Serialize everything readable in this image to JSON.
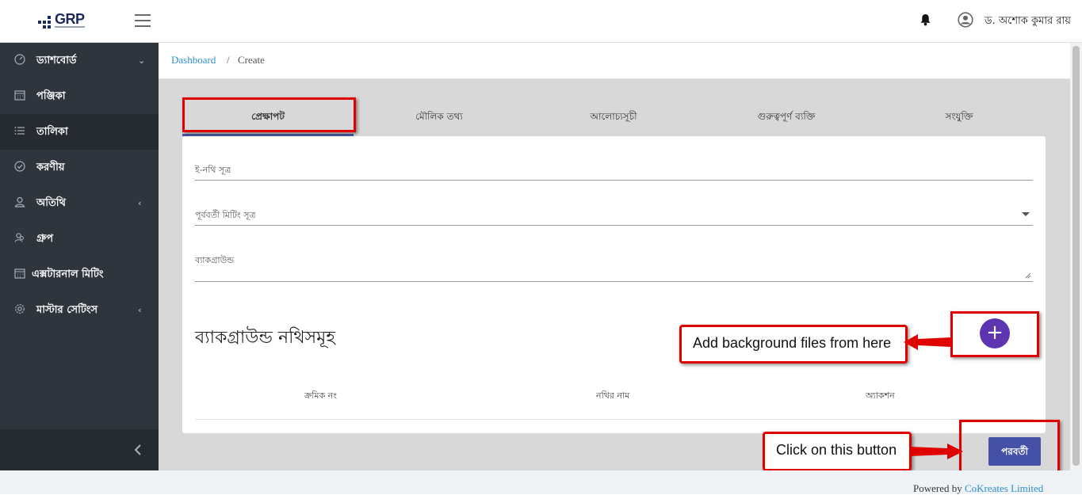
{
  "header": {
    "logo_text": "GRP",
    "user_name": "ড. অশোক কুমার রায়"
  },
  "sidebar": {
    "items": [
      {
        "label": "ড্যাশবোর্ড",
        "icon": "dashboard-gauge-icon",
        "chevron": "⌄"
      },
      {
        "label": "পঞ্জিকা",
        "icon": "calendar-icon",
        "chevron": ""
      },
      {
        "label": "তালিকা",
        "icon": "list-icon",
        "chevron": ""
      },
      {
        "label": "করণীয়",
        "icon": "check-circle-icon",
        "chevron": ""
      },
      {
        "label": "অতিথি",
        "icon": "user-icon",
        "chevron": "‹"
      },
      {
        "label": "গ্রুপ",
        "icon": "group-icon",
        "chevron": ""
      },
      {
        "label": "এক্সটারনাল মিটিং",
        "icon": "calendar-icon",
        "chevron": ""
      },
      {
        "label": "মাস্টার সেটিংস",
        "icon": "gear-icon",
        "chevron": "‹"
      }
    ]
  },
  "breadcrumb": {
    "link": "Dashboard",
    "separator": "/",
    "current": "Create"
  },
  "tabs": [
    {
      "label": "প্রেক্ষাপট"
    },
    {
      "label": "মৌলিক তথ্য"
    },
    {
      "label": "আলোচ্যসূচী"
    },
    {
      "label": "গুরুত্বপূর্ণ ব্যক্তি"
    },
    {
      "label": "সংযুক্তি"
    }
  ],
  "form": {
    "enothi_placeholder": "ই-নথি সূত্র",
    "previous_meeting_placeholder": "পূর্ববর্তী মিটিং সূত্র",
    "background_placeholder": "ব্যাকগ্রাউন্ড",
    "section_title": "ব্যাকগ্রাউন্ড নথিসমূহ",
    "add_button": "+",
    "columns": [
      "ক্রমিক নং",
      "নথির নাম",
      "অ্যাকশন"
    ]
  },
  "next_button": "পরবর্তী",
  "annotations": {
    "add_callout": "Add background files from here",
    "next_callout": "Click on this button",
    "color": "#e00000"
  },
  "footer": {
    "prefix": "Powered by",
    "company": "CoKreates Limited"
  },
  "colors": {
    "sidebar_bg": "#2f353d",
    "primary_button": "#4451a6",
    "add_button": "#5e35b1",
    "link": "#2d8fc9"
  }
}
